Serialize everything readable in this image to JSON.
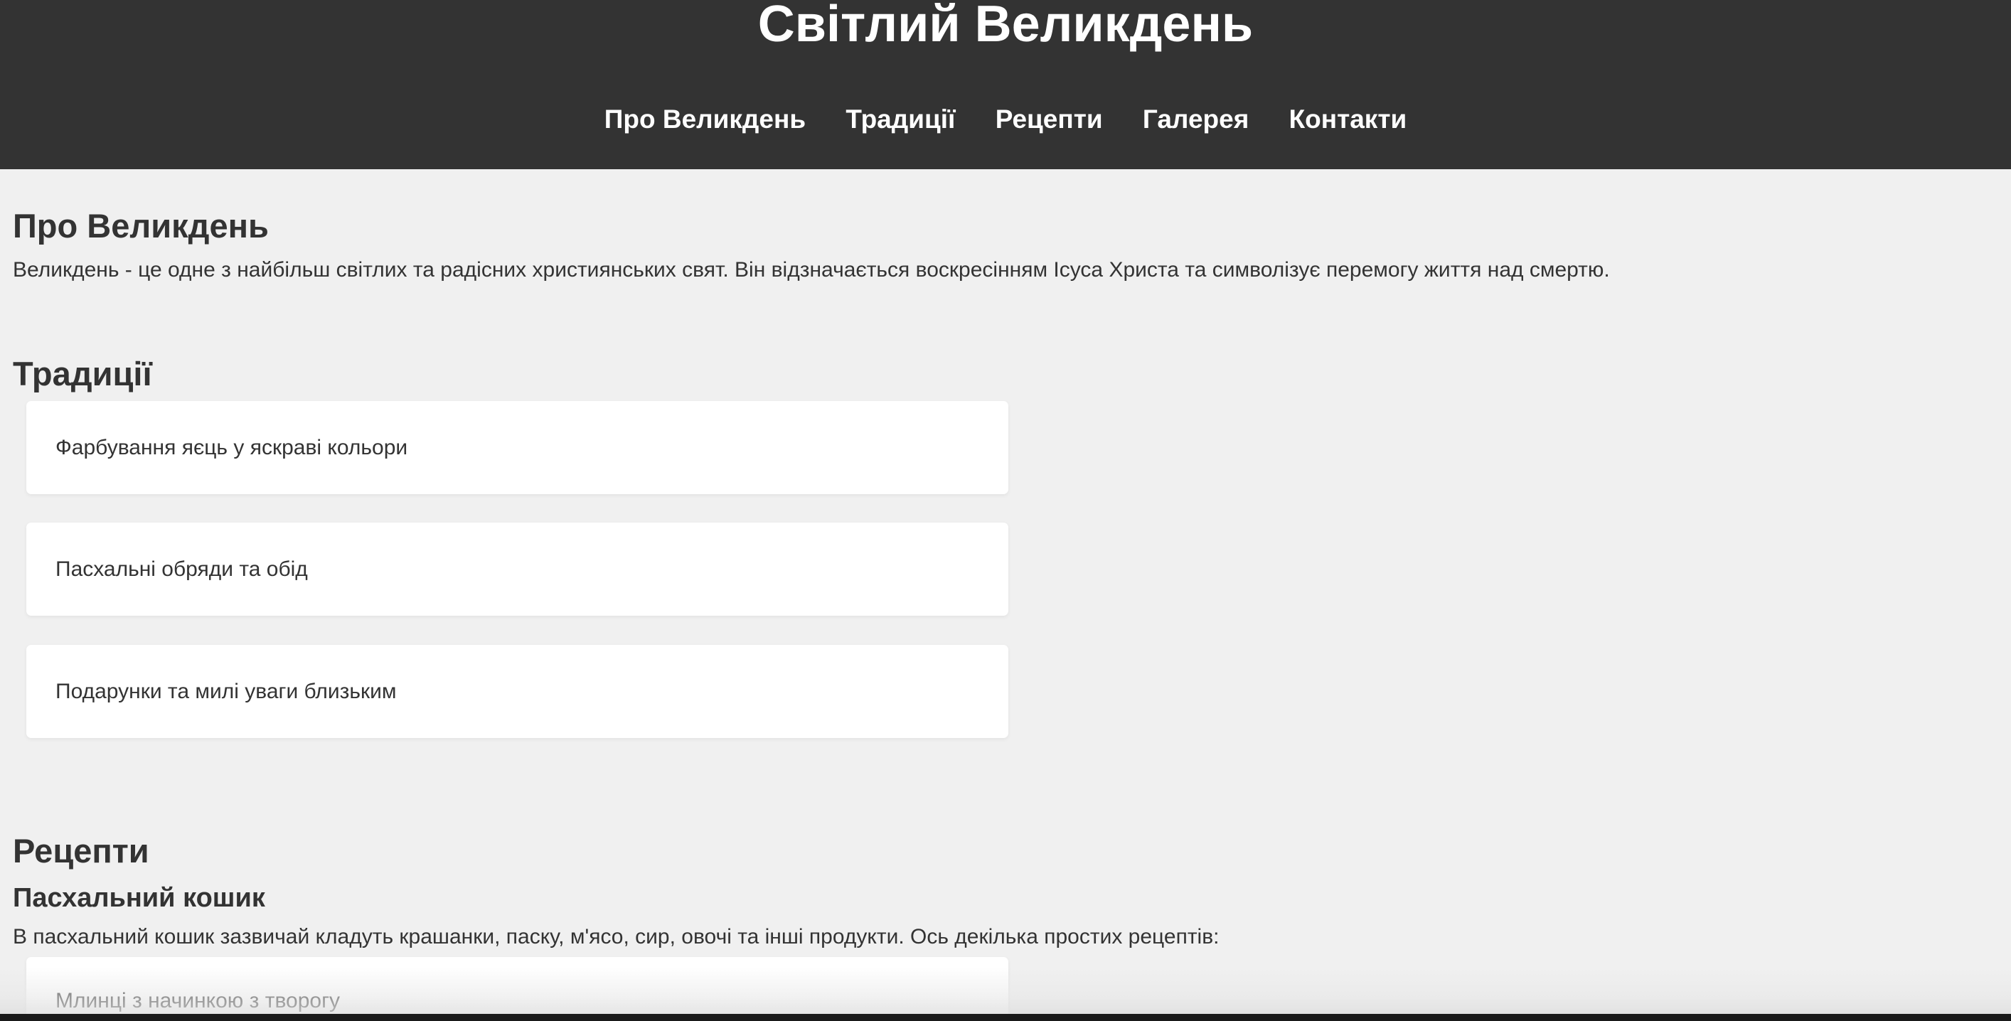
{
  "header": {
    "title": "Світлий Великдень",
    "nav": [
      {
        "label": "Про Великдень"
      },
      {
        "label": "Традиції"
      },
      {
        "label": "Рецепти"
      },
      {
        "label": "Галерея"
      },
      {
        "label": "Контакти"
      }
    ]
  },
  "about": {
    "heading": "Про Великдень",
    "text": "Великдень - це одне з найбільш світлих та радісних християнських свят. Він відзначається воскресінням Ісуса Христа та символізує перемогу життя над смертю."
  },
  "traditions": {
    "heading": "Традиції",
    "items": [
      {
        "label": "Фарбування яєць у яскраві кольори"
      },
      {
        "label": "Пасхальні обряди та обід"
      },
      {
        "label": "Подарунки та милі уваги близьким"
      }
    ]
  },
  "recipes": {
    "heading": "Рецепти",
    "subheading": "Пасхальний кошик",
    "text": "В пасхальний кошик зазвичай кладуть крашанки, паску, м'ясо, сир, овочі та інші продукти. Ось декілька простих рецептів:",
    "items": [
      {
        "label": "Млинці з начинкою з творогу"
      }
    ]
  },
  "colors": {
    "header_bg": "#333333",
    "page_bg": "#f0f0f0",
    "card_bg": "#ffffff",
    "text": "#333333"
  }
}
